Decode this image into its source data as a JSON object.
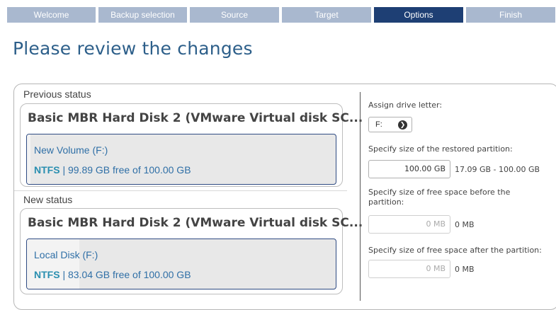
{
  "wizard": {
    "steps": [
      "Welcome",
      "Backup selection",
      "Source",
      "Target",
      "Options",
      "Finish"
    ],
    "active_step": "Options"
  },
  "page_title": "Please review the changes",
  "previous": {
    "label": "Previous status",
    "disk_title": "Basic MBR Hard Disk 2 (VMware Virtual disk SC...",
    "partition_name": "New Volume (F:)",
    "fs": "NTFS",
    "info": " | 99.89 GB free of 100.00 GB",
    "used_fraction": 0.0011
  },
  "new": {
    "label": "New status",
    "disk_title": "Basic MBR Hard Disk 2 (VMware Virtual disk SC...",
    "partition_name": "Local Disk (F:)",
    "fs": "NTFS",
    "info": " | 83.04 GB free of 100.00 GB",
    "used_fraction": 0.17
  },
  "options": {
    "drive_letter_label": "Assign drive letter:",
    "drive_letter_value": "F:",
    "size_label": "Specify size of the restored partition:",
    "size_value": "100.00 GB",
    "size_range": "17.09 GB - 100.00 GB",
    "before_label_line1": "Specify size of free space before the",
    "before_label_line2": "partition:",
    "before_value": "0 MB",
    "before_range": "0 MB",
    "after_label": "Specify size of free space after the partition:",
    "after_value": "0 MB",
    "after_range": "0 MB"
  },
  "colors": {
    "step_inactive": "#a9b8cf",
    "step_active": "#1e3f74",
    "title": "#2d5f8a",
    "partition_border": "#2f4b83",
    "partition_text": "#2f6fa6"
  }
}
